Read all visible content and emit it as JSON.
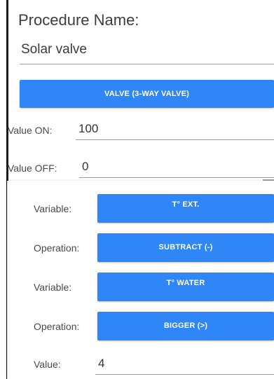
{
  "procedure": {
    "title": "Procedure Name:",
    "name_value": "Solar valve"
  },
  "valve_button": {
    "label": "VALVE (3-WAY VALVE)"
  },
  "value_on": {
    "label": "Value ON:",
    "value": "100"
  },
  "value_off": {
    "label": "Value OFF:",
    "value": "0"
  },
  "condition": {
    "rows": [
      {
        "label": "Variable:",
        "button": "T° EXT."
      },
      {
        "label": "Operation:",
        "button": "SUBTRACT (-)"
      },
      {
        "label": "Variable:",
        "button": "T° WATER"
      },
      {
        "label": "Operation:",
        "button": "BIGGER (>)"
      }
    ],
    "value_label": "Value:",
    "value": "4"
  },
  "colors": {
    "button_blue": "#2f86f6",
    "underline": "#9a9a9a",
    "text": "#333333"
  }
}
